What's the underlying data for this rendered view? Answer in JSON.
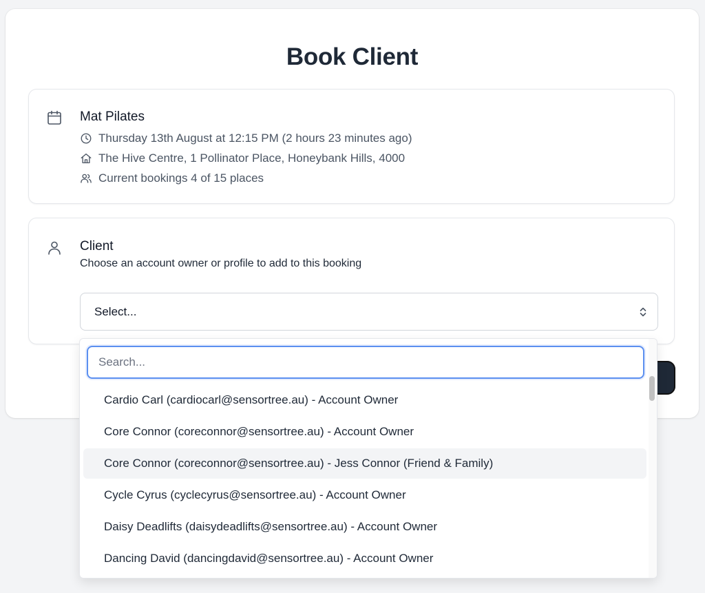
{
  "page": {
    "title": "Book Client"
  },
  "class_info": {
    "name": "Mat Pilates",
    "datetime": "Thursday 13th August at 12:15 PM (2 hours 23 minutes ago)",
    "location": "The Hive Centre, 1 Pollinator Place, Honeybank Hills, 4000",
    "bookings": "Current bookings 4 of 15 places",
    "icons": [
      "calendar-icon",
      "clock-icon",
      "home-icon",
      "users-icon"
    ]
  },
  "client": {
    "title": "Client",
    "subtitle": "Choose an account owner or profile to add to this booking",
    "select_value": "Select...",
    "icon": "user-icon"
  },
  "dropdown": {
    "search_placeholder": "Search...",
    "search_value": "",
    "highlighted_index": 2,
    "options": [
      "Cardio Carl (cardiocarl@sensortree.au) - Account Owner",
      "Core Connor (coreconnor@sensortree.au) - Account Owner",
      "Core Connor (coreconnor@sensortree.au) - Jess Connor (Friend & Family)",
      "Cycle Cyrus (cyclecyrus@sensortree.au) - Account Owner",
      "Daisy Deadlifts (daisydeadlifts@sensortree.au) - Account Owner",
      "Dancing David (dancingdavid@sensortree.au) - Account Owner"
    ]
  },
  "colors": {
    "focus_ring": "#5b8ff0",
    "highlight": "#f3f4f6",
    "button_dark": "#1f2937"
  }
}
